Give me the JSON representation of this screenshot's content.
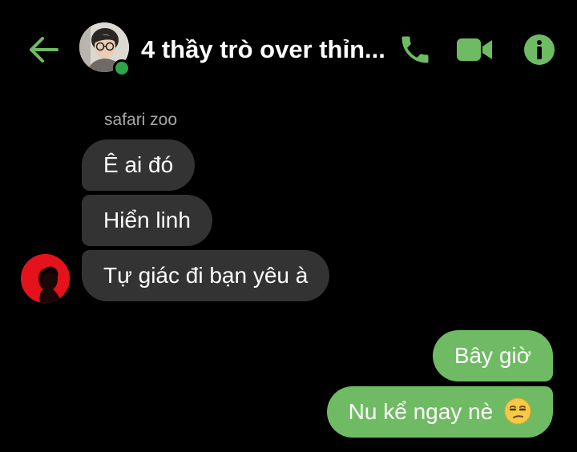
{
  "header": {
    "title": "4 thầy trò over thỉn...",
    "back_icon": "arrow-left-icon",
    "call_icon": "phone-icon",
    "video_icon": "video-camera-icon",
    "info_icon": "info-icon",
    "accent_color": "#6fbb63",
    "online_status_color": "#31a24c"
  },
  "conversation": {
    "sender_name": "safari zoo",
    "incoming_messages": [
      {
        "text": "Ê ai đó"
      },
      {
        "text": "Hiển linh"
      },
      {
        "text": "Tự giác đi bạn yêu à"
      }
    ],
    "outgoing_messages": [
      {
        "text": "Bây giờ"
      },
      {
        "text": "Nu kể ngay nè",
        "emoji": "unamused-face-emoji"
      }
    ],
    "incoming_bubble_color": "#333333",
    "outgoing_bubble_color": "#6fbb63"
  }
}
